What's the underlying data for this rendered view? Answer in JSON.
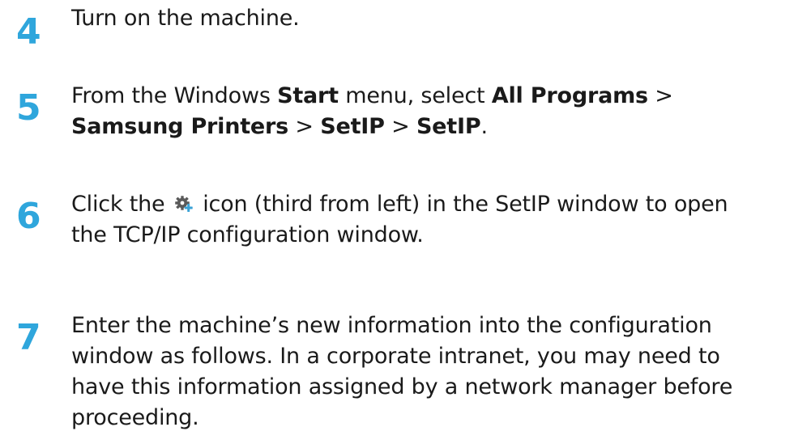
{
  "steps": [
    {
      "number": "4",
      "lines": [
        [
          {
            "t": "Turn on the machine."
          }
        ]
      ]
    },
    {
      "number": "5",
      "lines": [
        [
          {
            "t": "From the Windows "
          },
          {
            "t": "Start",
            "b": true
          },
          {
            "t": " menu, select "
          },
          {
            "t": "All Programs",
            "b": true
          },
          {
            "t": " >"
          }
        ],
        [
          {
            "t": "Samsung Printers",
            "b": true
          },
          {
            "t": " > "
          },
          {
            "t": "SetIP",
            "b": true
          },
          {
            "t": " > "
          },
          {
            "t": "SetIP",
            "b": true
          },
          {
            "t": "."
          }
        ]
      ]
    },
    {
      "number": "6",
      "lines": [
        [
          {
            "t": "Click the "
          },
          {
            "icon": "gear-icon"
          },
          {
            "t": " icon (third from left) in the SetIP window to open"
          }
        ],
        [
          {
            "t": "the TCP/IP configuration window."
          }
        ]
      ]
    },
    {
      "number": "7",
      "lines": [
        [
          {
            "t": "Enter the machine’s new information into the configuration"
          }
        ],
        [
          {
            "t": "window as follows. In a corporate intranet, you may need to"
          }
        ],
        [
          {
            "t": "have this information assigned by a network manager before"
          }
        ],
        [
          {
            "t": "proceeding."
          }
        ]
      ]
    }
  ],
  "colors": {
    "step_number": "#2fa6dc",
    "text": "#1a1a1a",
    "icon_gear": "#5a5a5a",
    "icon_plus": "#3aa2d6"
  }
}
